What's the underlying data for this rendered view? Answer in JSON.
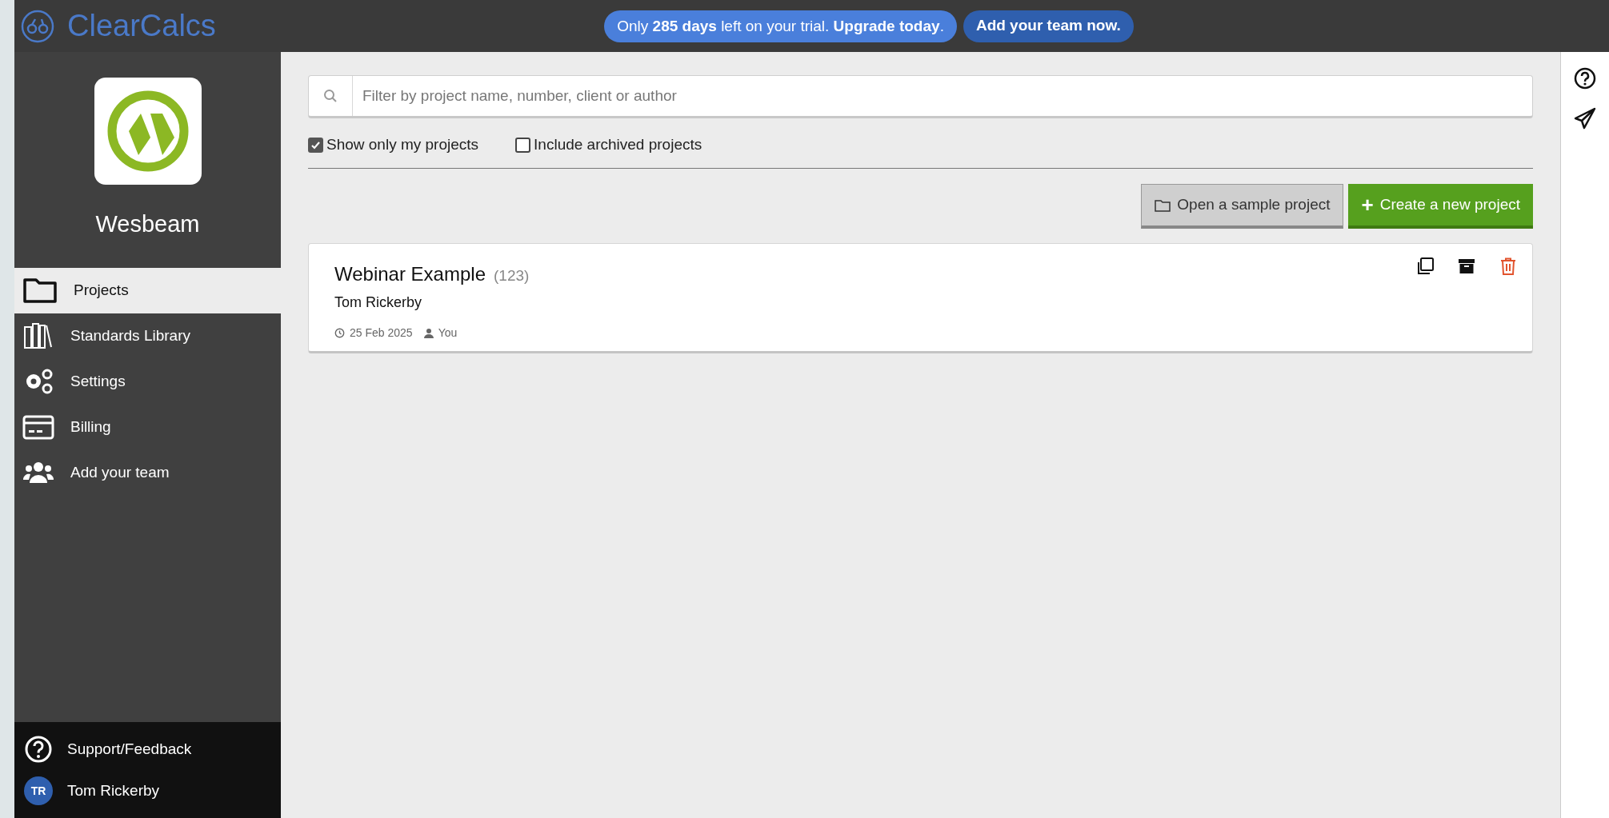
{
  "app": {
    "name": "ClearCalcs"
  },
  "banner": {
    "trial_text": "Only **285 days** left on your trial. **Upgrade today**.",
    "team_button": "Add your team now."
  },
  "sidebar": {
    "company": "Wesbeam",
    "items": [
      {
        "label": "Projects",
        "selected": true
      },
      {
        "label": "Standards Library",
        "selected": false
      },
      {
        "label": "Settings",
        "selected": false
      },
      {
        "label": "Billing",
        "selected": false
      },
      {
        "label": "Add your team",
        "selected": false
      }
    ],
    "support": "Support/Feedback",
    "user": {
      "initials": "TR",
      "name": "Tom Rickerby"
    }
  },
  "filter": {
    "placeholder": "Filter by project name, number, client or author",
    "options": [
      {
        "label": "Show only my projects",
        "checked": true
      },
      {
        "label": "Include archived projects",
        "checked": false
      }
    ]
  },
  "actions": {
    "sample": "Open a sample project",
    "create_icon": "+",
    "create": "Create a new project"
  },
  "projects": [
    {
      "title": "Webinar Example",
      "number": "(123)",
      "author": "Tom Rickerby",
      "date": "25 Feb 2025",
      "owner": "You"
    }
  ]
}
